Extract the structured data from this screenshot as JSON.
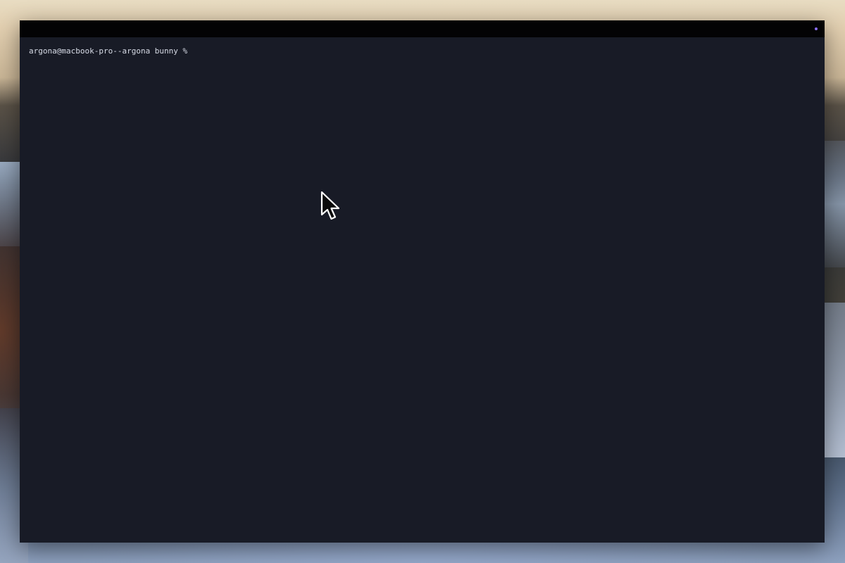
{
  "desktop": {
    "wallpaper": "desktop-wallpaper"
  },
  "terminal": {
    "prompt": "argona@macbook-pro--argona bunny %",
    "status_dot_color": "#8a6df2",
    "background_color": "#181b26",
    "titlebar_color": "#030304"
  },
  "icons": {
    "cursor": "mouse-pointer-icon",
    "status": "status-dot-icon"
  }
}
